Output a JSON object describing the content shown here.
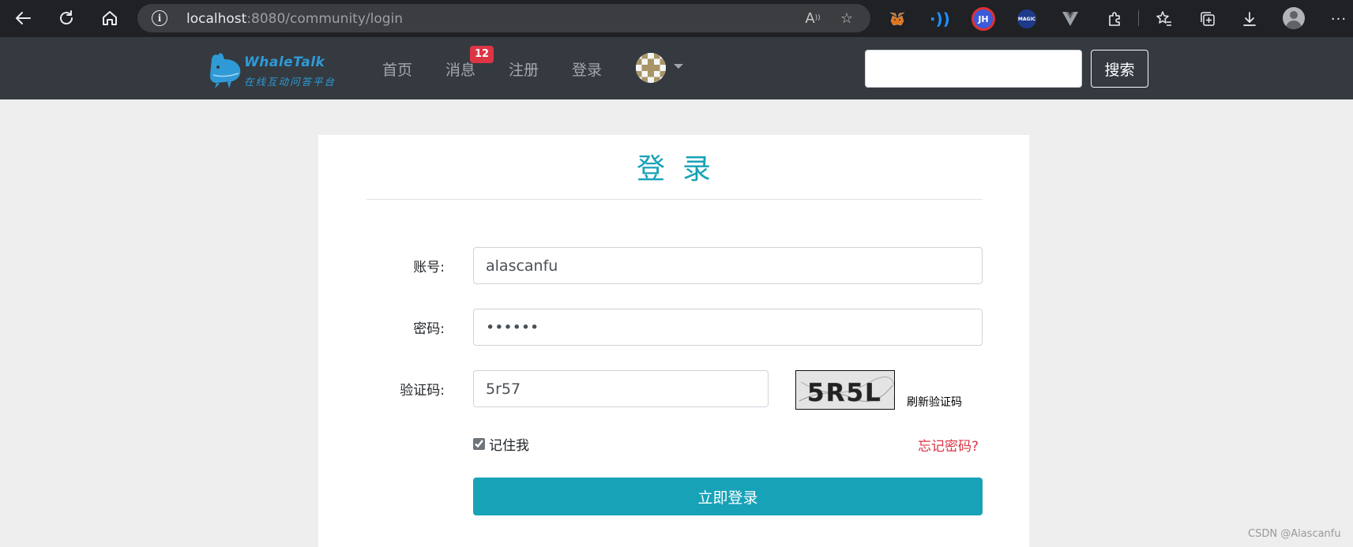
{
  "browser": {
    "url_host": "localhost",
    "url_rest": ":8080/community/login",
    "buttons": [
      "back",
      "refresh",
      "home"
    ],
    "extension_jh_label": "JH",
    "extension_magic_label": "MAGIC"
  },
  "site": {
    "logo_name": "WhaleTalk",
    "logo_slogan": "在线互动问答平台",
    "nav": {
      "home": "首页",
      "messages": "消息",
      "messages_badge": "12",
      "register": "注册",
      "login": "登录"
    },
    "search": {
      "value": "",
      "button": "搜索"
    }
  },
  "login": {
    "title": "登录",
    "username_label": "账号:",
    "username_value": "alascanfu",
    "password_label": "密码:",
    "password_value": "123456",
    "captcha_label": "验证码:",
    "captcha_value": "5r57",
    "captcha_image_text": "5R5L",
    "refresh_captcha": "刷新验证码",
    "remember_me": "记住我",
    "remember_checked": true,
    "forgot_password": "忘记密码?",
    "submit": "立即登录"
  },
  "watermark": "CSDN @Alascanfu",
  "colors": {
    "primary": "#17a2b8",
    "danger": "#dc3545",
    "navbar": "#343a40",
    "logo": "#2f9ad6"
  }
}
